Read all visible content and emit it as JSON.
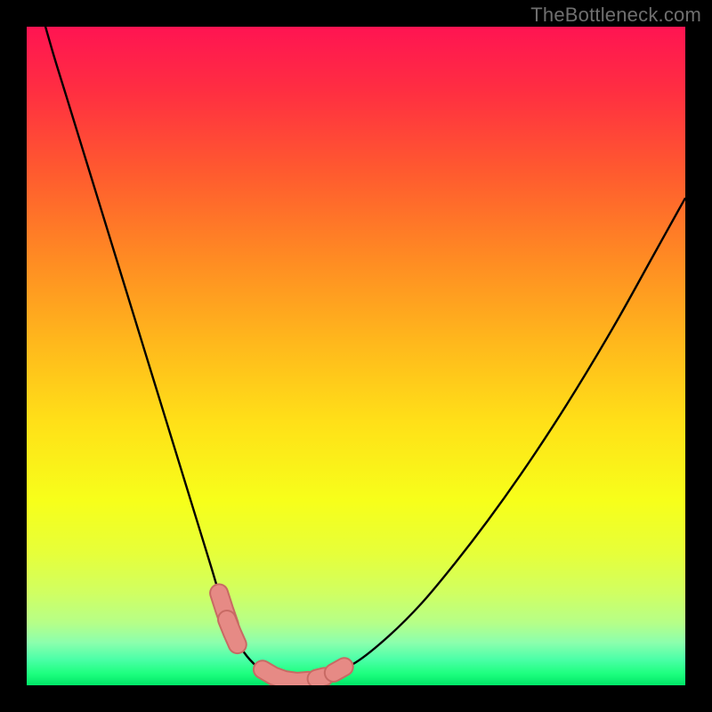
{
  "watermark": "TheBottleneck.com",
  "colors": {
    "frame": "#000000",
    "gradient_stops": [
      {
        "offset": 0.0,
        "color": "#ff1452"
      },
      {
        "offset": 0.1,
        "color": "#ff2f41"
      },
      {
        "offset": 0.22,
        "color": "#ff5a2f"
      },
      {
        "offset": 0.35,
        "color": "#ff8a23"
      },
      {
        "offset": 0.48,
        "color": "#ffb81c"
      },
      {
        "offset": 0.6,
        "color": "#ffe018"
      },
      {
        "offset": 0.72,
        "color": "#f7ff1a"
      },
      {
        "offset": 0.8,
        "color": "#e6ff3a"
      },
      {
        "offset": 0.86,
        "color": "#d0ff62"
      },
      {
        "offset": 0.905,
        "color": "#b6ff88"
      },
      {
        "offset": 0.935,
        "color": "#8cffad"
      },
      {
        "offset": 0.96,
        "color": "#4dffa8"
      },
      {
        "offset": 0.982,
        "color": "#1eff7f"
      },
      {
        "offset": 1.0,
        "color": "#00e667"
      }
    ],
    "curve": "#000000",
    "blob_fill": "#e68a85",
    "blob_stroke": "#c86a64"
  },
  "chart_data": {
    "type": "line",
    "title": "",
    "xlabel": "",
    "ylabel": "",
    "xlim": [
      0,
      100
    ],
    "ylim": [
      0,
      100
    ],
    "series": [
      {
        "name": "bottleneck-curve",
        "x": [
          0,
          2,
          4,
          6,
          8,
          10,
          12,
          14,
          16,
          18,
          20,
          22,
          24,
          26,
          28,
          29.5,
          31,
          33,
          35,
          37,
          39,
          40.5,
          42,
          45,
          50,
          55,
          60,
          65,
          70,
          75,
          80,
          85,
          90,
          95,
          100
        ],
        "y": [
          110,
          103,
          96,
          89.5,
          83,
          76.5,
          70,
          63.5,
          57,
          50.5,
          44,
          37.5,
          31,
          24.5,
          18,
          13,
          8.5,
          5,
          2.8,
          1.5,
          0.8,
          0.5,
          0.6,
          1.2,
          3.5,
          7.5,
          12.5,
          18.5,
          25,
          32,
          39.5,
          47.5,
          56,
          65,
          74
        ]
      }
    ],
    "markers": {
      "name": "highlight-blobs",
      "segments": [
        {
          "x": [
            29.2,
            30.0,
            30.8
          ],
          "y": [
            14.0,
            11.5,
            9.2
          ]
        },
        {
          "x": [
            30.4,
            31.2,
            32.0
          ],
          "y": [
            10.0,
            8.0,
            6.2
          ]
        },
        {
          "x": [
            35.8,
            37.5,
            39.2,
            41.0,
            42.8
          ],
          "y": [
            2.4,
            1.4,
            0.8,
            0.55,
            0.7
          ]
        },
        {
          "x": [
            44.0,
            45.2
          ],
          "y": [
            1.0,
            1.3
          ]
        },
        {
          "x": [
            46.6,
            48.2
          ],
          "y": [
            1.9,
            2.8
          ]
        }
      ]
    }
  }
}
